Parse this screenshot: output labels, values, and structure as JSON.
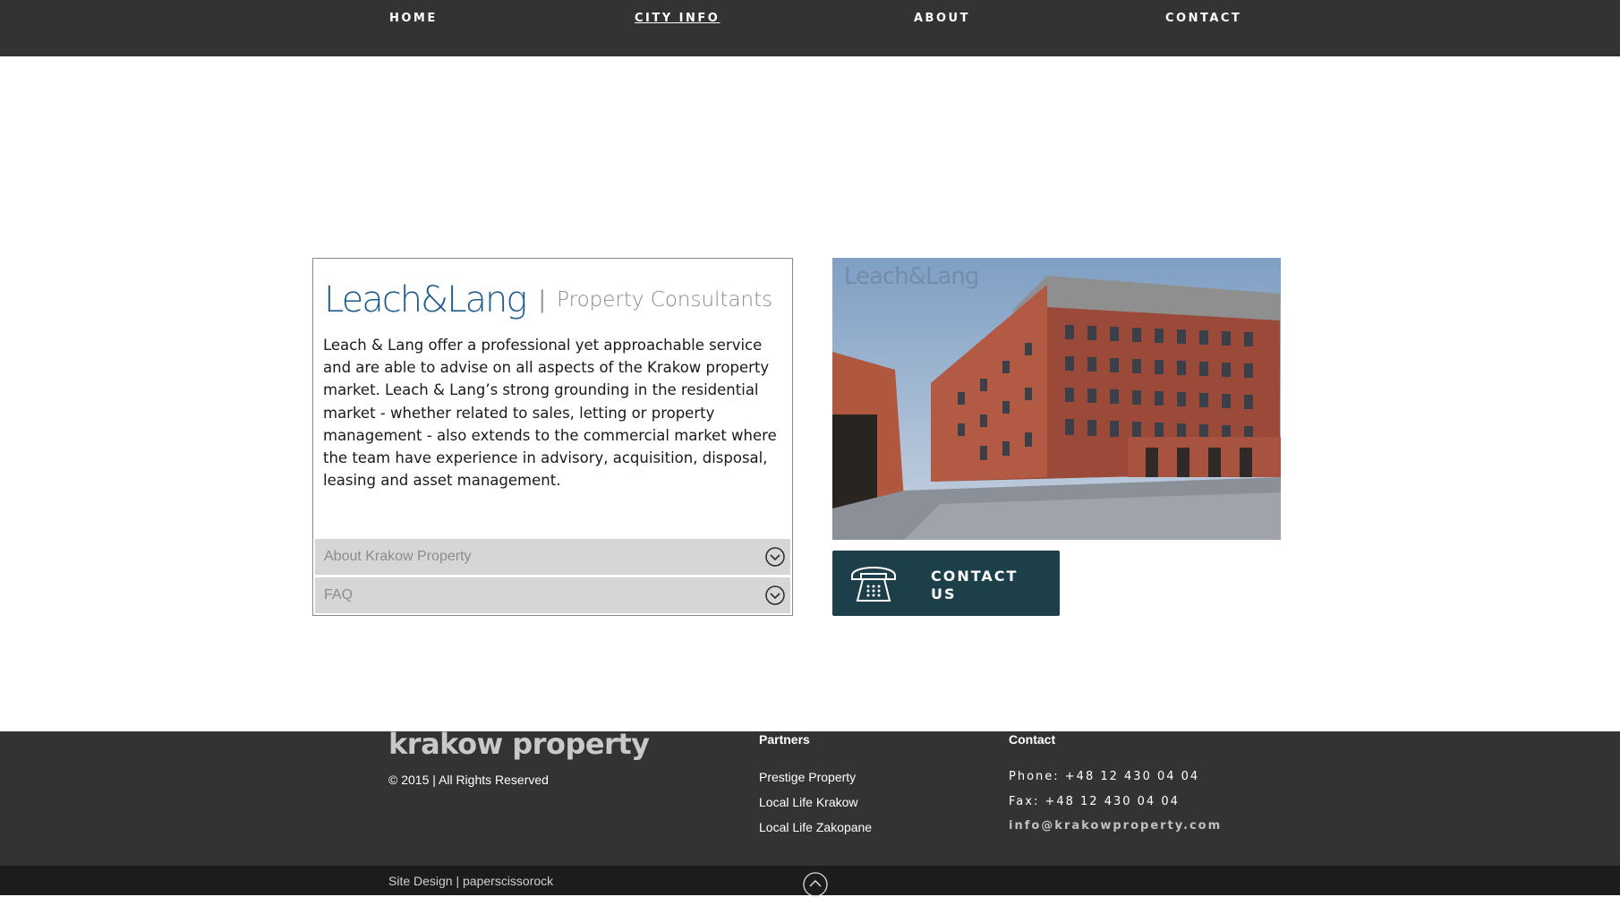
{
  "nav": {
    "items": [
      {
        "label": "HOME",
        "active": false
      },
      {
        "label": "CITY INFO",
        "active": true
      },
      {
        "label": "ABOUT",
        "active": false
      },
      {
        "label": "CONTACT",
        "active": false
      }
    ]
  },
  "card": {
    "brand_name": "Leach&Lang",
    "brand_separator": "|",
    "brand_tagline": "Property Consultants",
    "intro": "Leach & Lang offer a professional yet approachable service and are able to advise on all aspects of the Krakow property market. Leach & Lang’s strong grounding in the residential market - whether related to sales, letting or property management - also extends to the commercial market where the team have experience in advisory, acquisition, disposal, leasing and asset management.",
    "accordion": [
      {
        "label": "About Krakow Property",
        "icon": "chevron-down-circle-icon"
      },
      {
        "label": "FAQ",
        "icon": "chevron-down-circle-icon"
      }
    ]
  },
  "photo": {
    "watermark": "Leach&Lang"
  },
  "contact_button": {
    "label": "CONTACT US",
    "icon": "telephone-icon",
    "background": "#1d3f4a"
  },
  "footer": {
    "brand": "krakow property",
    "copyright": "© 2015 | All Rights Reserved",
    "partners_heading": "Partners",
    "partners": [
      "Prestige Property",
      "Local Life Krakow",
      "Local Life Zakopane"
    ],
    "contact_heading": "Contact",
    "phone": "Phone: +48 12 430 04 04",
    "fax": "Fax: +48 12 430 04 04",
    "email": "info@krakowproperty.com"
  },
  "bottom_bar": {
    "credit": "Site Design | paperscissorock",
    "back_to_top_icon": "chevron-up-circle-icon"
  },
  "colors": {
    "nav_bg": "#333333",
    "footer_bg": "#333333",
    "bottom_bg": "#1c1c1c",
    "brand_blue": "#1e5b8f"
  }
}
